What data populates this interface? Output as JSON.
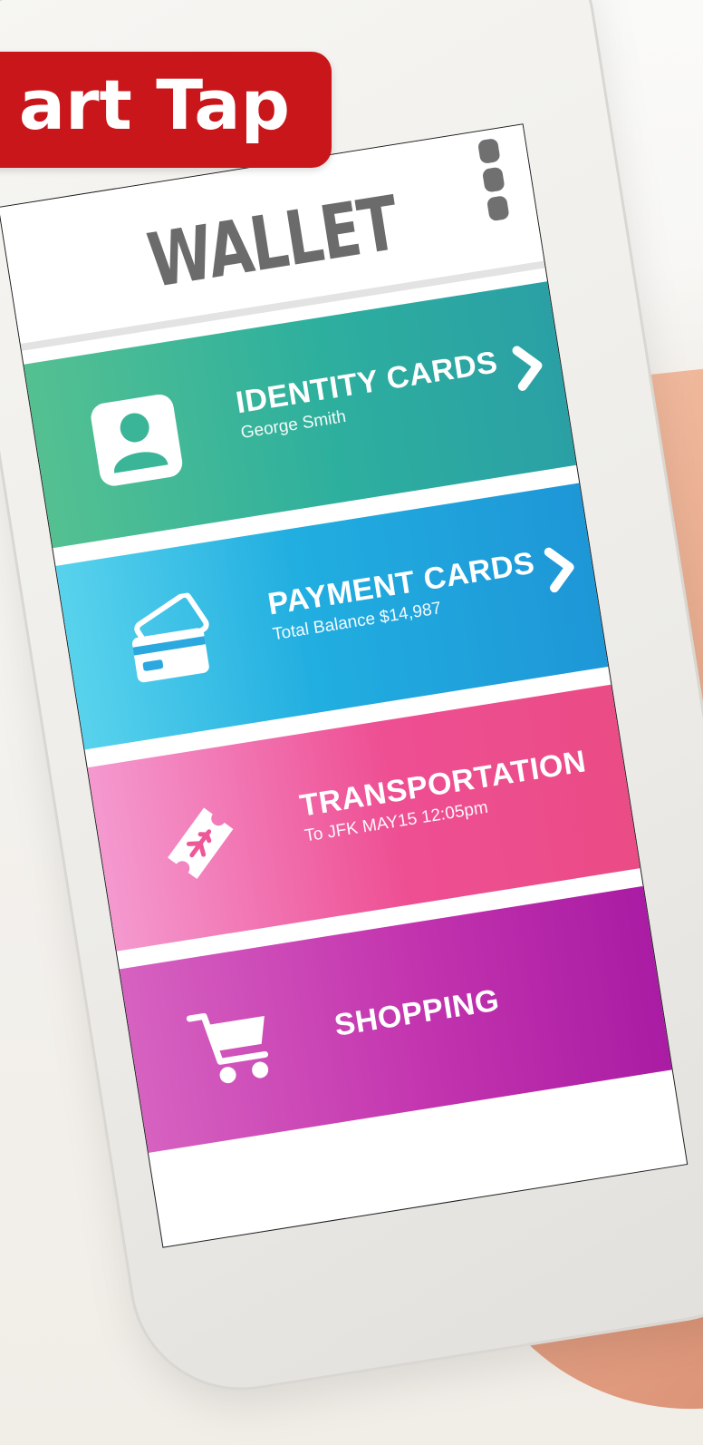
{
  "banner": {
    "text": "art Tap"
  },
  "screen": {
    "title": "WALLET",
    "menu_icon": "more-vertical-icon"
  },
  "cards": [
    {
      "title": "IDENTITY CARDS",
      "subtitle": "George Smith",
      "icon": "person-icon",
      "has_chevron": true
    },
    {
      "title": "PAYMENT CARDS",
      "subtitle": "Total Balance $14,987",
      "icon": "credit-card-icon",
      "has_chevron": true
    },
    {
      "title": "TRANSPORTATION",
      "subtitle": "To JFK MAY15 12:05pm",
      "icon": "plane-ticket-icon",
      "has_chevron": false
    },
    {
      "title": "SHOPPING",
      "subtitle": "",
      "icon": "shopping-cart-icon",
      "has_chevron": false
    }
  ],
  "colors": {
    "banner": "#c8161b",
    "identity": "#2daf9e",
    "payment": "#21aee0",
    "transportation": "#ee4f93",
    "shopping": "#c233ae",
    "title_text": "#6b6b6b"
  }
}
